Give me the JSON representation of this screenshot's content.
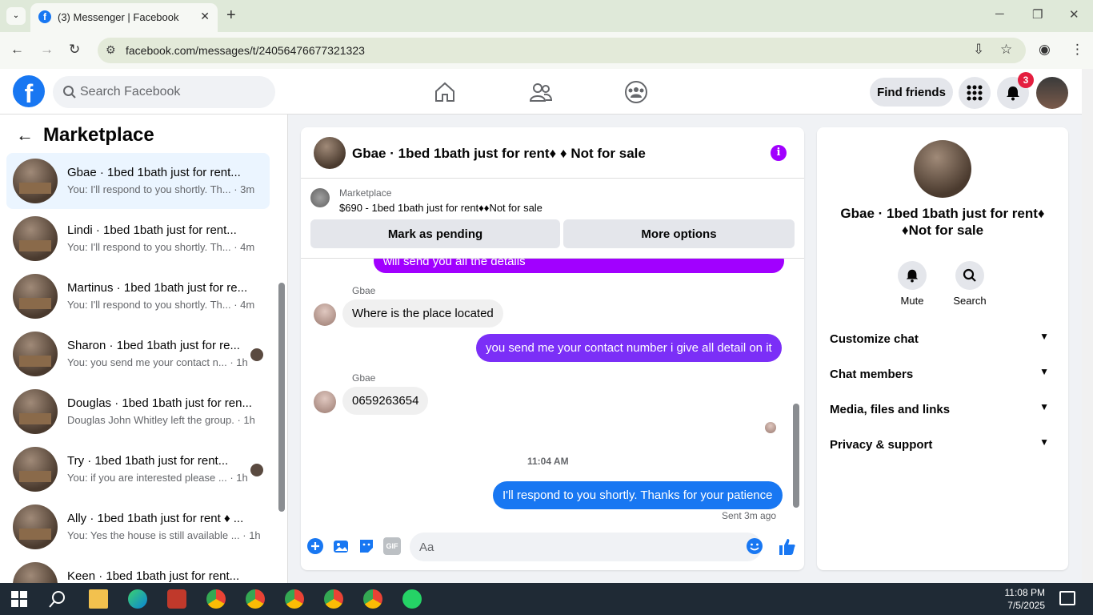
{
  "browser": {
    "tab_title": "(3) Messenger | Facebook",
    "url": "facebook.com/messages/t/24056476677321323"
  },
  "fb": {
    "search_placeholder": "Search Facebook",
    "find_friends": "Find friends",
    "notification_count": "3"
  },
  "left": {
    "title": "Marketplace",
    "conversations": [
      {
        "name": "Gbae · 1bed 1bath just for rent...",
        "preview": "You: I'll respond to you shortly. Th...",
        "time": "· 3m"
      },
      {
        "name": "Lindi · 1bed 1bath just for rent...",
        "preview": "You: I'll respond to you shortly. Th...",
        "time": "· 4m"
      },
      {
        "name": "Martinus · 1bed 1bath just for re...",
        "preview": "You: I'll respond to you shortly. Th...",
        "time": "· 4m"
      },
      {
        "name": "Sharon · 1bed 1bath just for re...",
        "preview": "You: you send me your contact n...",
        "time": "· 1h"
      },
      {
        "name": "Douglas · 1bed 1bath just for ren...",
        "preview": "Douglas John Whitley left the group.",
        "time": "· 1h"
      },
      {
        "name": "Try · 1bed 1bath just for rent...",
        "preview": "You: if you are interested please ...",
        "time": "· 1h"
      },
      {
        "name": "Ally · 1bed 1bath just for rent ♦ ...",
        "preview": "You: Yes the house is still available ...",
        "time": "· 1h"
      },
      {
        "name": "Keen · 1bed 1bath just for rent...",
        "preview": "",
        "time": ""
      }
    ]
  },
  "chat": {
    "title": "Gbae · 1bed 1bath just for rent♦ ♦ Not for sale",
    "marketplace_label": "Marketplace",
    "item": "$690 - 1bed 1bath just for rent♦♦Not for sale",
    "mark_pending": "Mark as pending",
    "more_options": "More options",
    "messages": [
      {
        "text": "will send you all the details"
      },
      {
        "sender": "Gbae",
        "text": "Where is the place located"
      },
      {
        "text": "you send me your contact number i give all detail on it"
      },
      {
        "sender": "Gbae",
        "text": "0659263654"
      },
      {
        "timestamp": "11:04 AM"
      },
      {
        "text": "I'll respond to you shortly. Thanks for your patience"
      }
    ],
    "status": "Sent 3m ago",
    "input_placeholder": "Aa",
    "gif_label": "GIF"
  },
  "right": {
    "name": "Gbae · 1bed 1bath just for rent♦ ♦Not for sale",
    "mute": "Mute",
    "search": "Search",
    "rows": [
      "Customize chat",
      "Chat members",
      "Media, files and links",
      "Privacy & support"
    ]
  },
  "taskbar": {
    "time": "11:08 PM",
    "date": "7/5/2025"
  },
  "colors": {
    "fb_blue": "#1877f2",
    "purple": "#a100ff",
    "violet": "#7b2ff7"
  }
}
